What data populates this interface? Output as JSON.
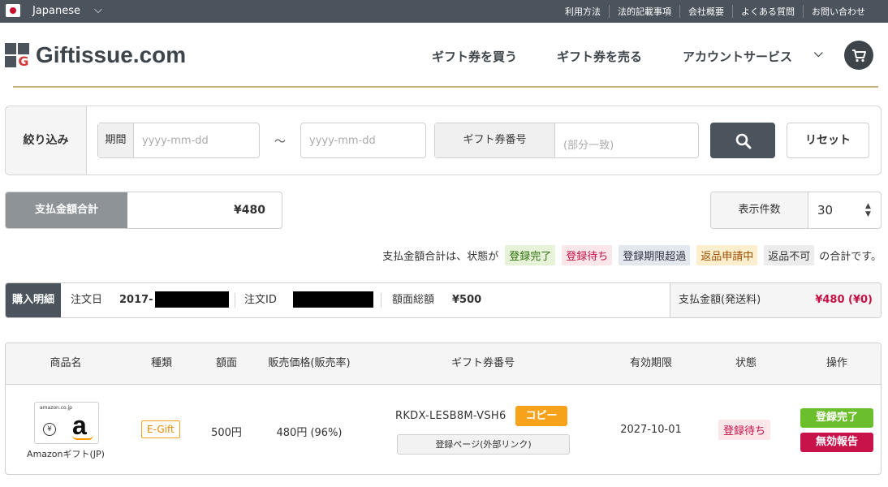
{
  "topbar": {
    "language": "Japanese",
    "links": [
      "利用方法",
      "法的記載事項",
      "会社概要",
      "よくある質問",
      "お問い合わせ"
    ]
  },
  "header": {
    "logo_text": "Giftissue.com",
    "nav": [
      "ギフト券を買う",
      "ギフト券を売る",
      "アカウントサービス"
    ],
    "cart_icon": "cart-icon"
  },
  "filter": {
    "label": "絞り込み",
    "period_label": "期間",
    "date_from_placeholder": "yyyy-mm-dd",
    "separator": "～",
    "date_to_placeholder": "yyyy-mm-dd",
    "gift_number_label": "ギフト券番号",
    "gift_number_placeholder": "(部分一致)",
    "search_icon": "search-icon",
    "reset_label": "リセット"
  },
  "summary": {
    "total_label": "支払金額合計",
    "total_value": "¥480",
    "per_page_label": "表示件数",
    "per_page_value": "30"
  },
  "legend": {
    "prefix": "支払金額合計は、状態が",
    "statuses": [
      "登録完了",
      "登録待ち",
      "登録期限超過",
      "返品申請中",
      "返品不可"
    ],
    "suffix": "の合計です。"
  },
  "order": {
    "label": "購入明細",
    "date_label": "注文日",
    "date_value": "2017-",
    "id_label": "注文ID",
    "face_total_label": "額面総額",
    "face_total_value": "¥500",
    "pay_label": "支払金額(発送料)",
    "pay_value": "¥480 (¥0)"
  },
  "table": {
    "headers": [
      "商品名",
      "種類",
      "額面",
      "販売価格(販売率)",
      "ギフト券番号",
      "有効期限",
      "状態",
      "操作"
    ],
    "row": {
      "image_text": "amazon.co.jp",
      "image_yen": "¥",
      "image_letter": "a",
      "product": "Amazonギフト(JP)",
      "type": "E-Gift",
      "face": "500円",
      "price": "480円 (96%)",
      "code": "RKDX-LESB8M-VSH6",
      "copy_label": "コピー",
      "link_label": "登録ページ(外部リンク)",
      "expiry": "2027-10-01",
      "status": "登録待ち",
      "action_ok": "登録完了",
      "action_ng": "無効報告"
    }
  }
}
